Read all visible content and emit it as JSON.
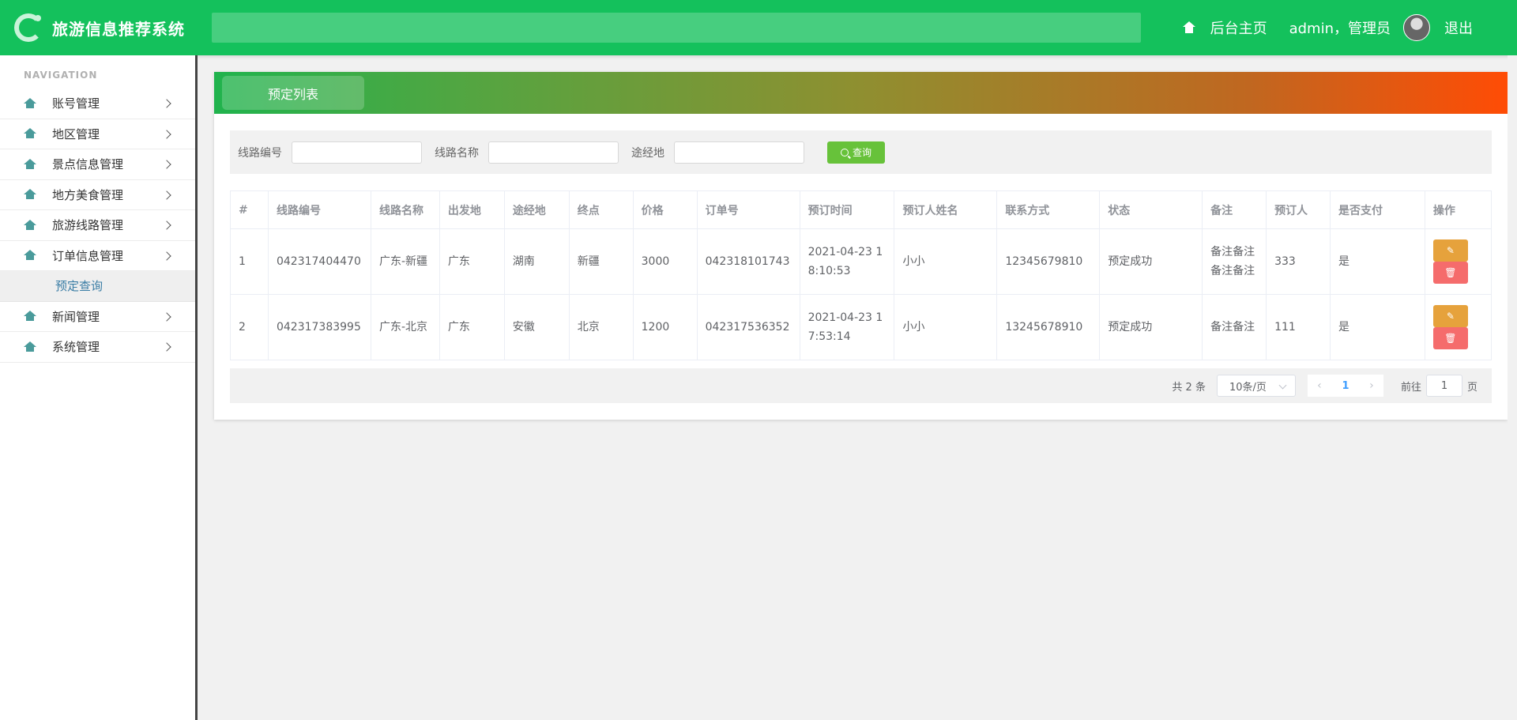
{
  "header": {
    "app_title": "旅游信息推荐系统",
    "home_link": "后台主页",
    "user_text": "admin，管理员",
    "logout": "退出"
  },
  "sidebar": {
    "caption": "NAVIGATION",
    "items": [
      {
        "label": "账号管理"
      },
      {
        "label": "地区管理"
      },
      {
        "label": "景点信息管理"
      },
      {
        "label": "地方美食管理"
      },
      {
        "label": "旅游线路管理"
      },
      {
        "label": "订单信息管理"
      }
    ],
    "sub_item": "预定查询",
    "items_after": [
      {
        "label": "新闻管理"
      },
      {
        "label": "系统管理"
      }
    ]
  },
  "panel": {
    "tab": "预定列表"
  },
  "search": {
    "label_code": "线路编号",
    "label_name": "线路名称",
    "label_via": "途经地",
    "button": "查询"
  },
  "table": {
    "headers": [
      "#",
      "线路编号",
      "线路名称",
      "出发地",
      "途经地",
      "终点",
      "价格",
      "订单号",
      "预订时间",
      "预订人姓名",
      "联系方式",
      "状态",
      "备注",
      "预订人",
      "是否支付",
      "操作"
    ],
    "rows": [
      [
        "1",
        "042317404470",
        "广东-新疆",
        "广东",
        "湖南",
        "新疆",
        "3000",
        "042318101743",
        "2021-04-23 18:10:53",
        "小小",
        "12345679810",
        "预定成功",
        "备注备注备注备注",
        "333",
        "是"
      ],
      [
        "2",
        "042317383995",
        "广东-北京",
        "广东",
        "安徽",
        "北京",
        "1200",
        "042317536352",
        "2021-04-23 17:53:14",
        "小小",
        "13245678910",
        "预定成功",
        "备注备注",
        "111",
        "是"
      ]
    ]
  },
  "pager": {
    "total": "共 2 条",
    "page_size": "10条/页",
    "current": "1",
    "goto_prefix": "前往",
    "goto_value": "1",
    "goto_suffix": "页"
  },
  "colors": {
    "header": "#14c15c",
    "search_button": "#67c23a",
    "edit_button": "#e6a23c",
    "delete_button": "#f56c6c"
  }
}
